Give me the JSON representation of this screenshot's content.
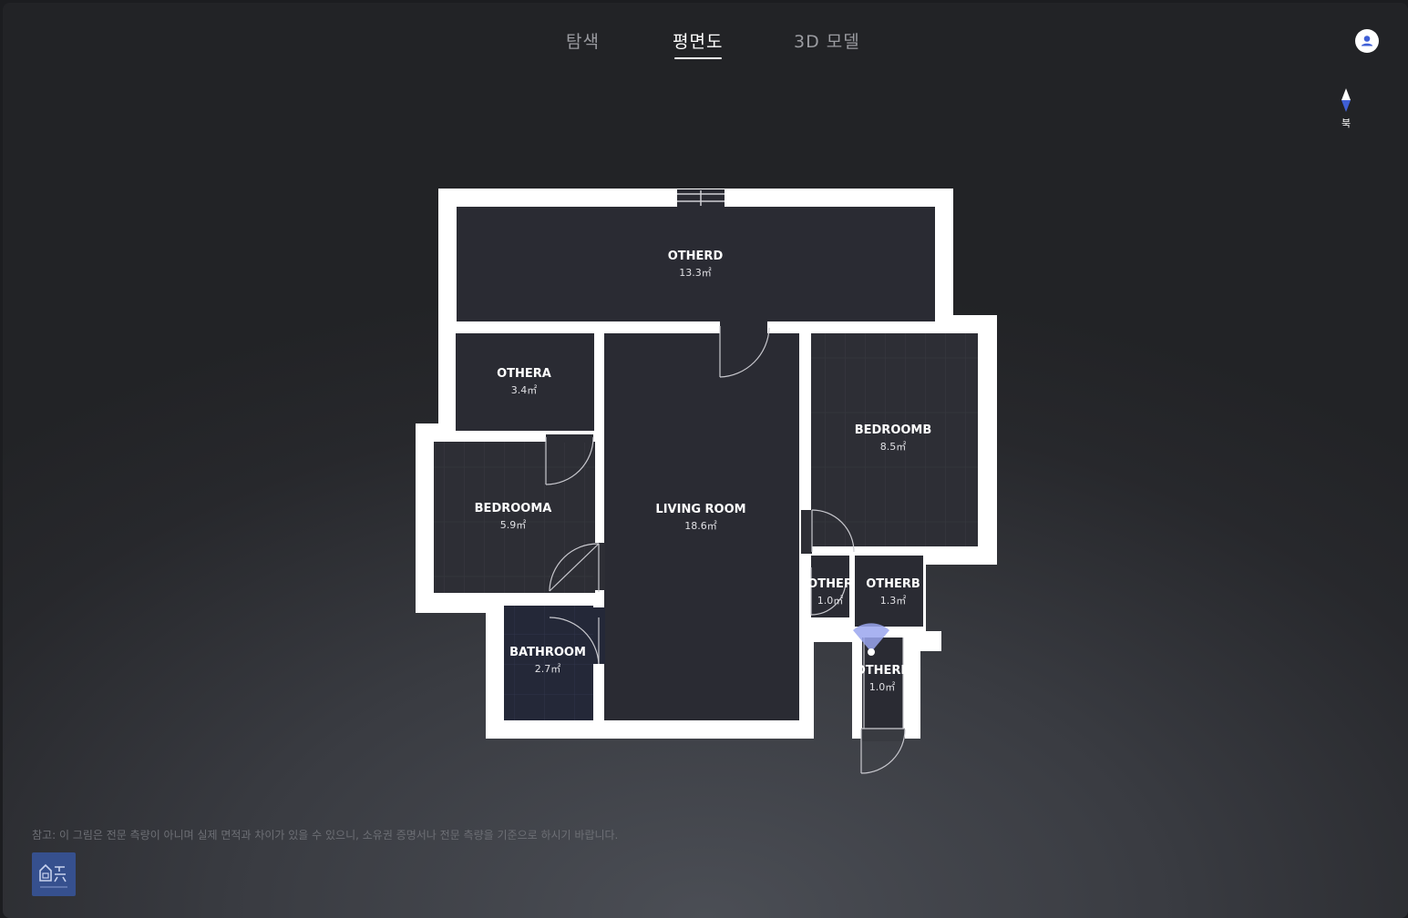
{
  "tabs": [
    {
      "label": "탐색",
      "active": false
    },
    {
      "label": "평면도",
      "active": true
    },
    {
      "label": "3D 모델",
      "active": false
    }
  ],
  "compass": {
    "label": "북"
  },
  "rooms": {
    "otherd": {
      "name": "OTHERD",
      "area": "13.3㎡"
    },
    "othera": {
      "name": "OTHERA",
      "area": "3.4㎡"
    },
    "bedrooma": {
      "name": "BEDROOMA",
      "area": "5.9㎡"
    },
    "living": {
      "name": "LIVING ROOM",
      "area": "18.6㎡"
    },
    "bedroomb": {
      "name": "BEDROOMB",
      "area": "8.5㎡"
    },
    "other": {
      "name": "OTHER",
      "area": "1.0㎡"
    },
    "otherb": {
      "name": "OTHERB",
      "area": "1.3㎡"
    },
    "othere": {
      "name": "OTHERE",
      "area": "1.0㎡"
    },
    "bathroom": {
      "name": "BATHROOM",
      "area": "2.7㎡"
    }
  },
  "disclaimer": "참고: 이 그림은 전문 측량이 아니며 실제 면적과 차이가 있을 수 있으니, 소유권 증명서나 전문 측량을 기준으로 하시기 바랍니다.",
  "colors": {
    "wall": "#ffffff",
    "floor": "#2a2b33",
    "accent": "#3f5fd6",
    "logo": "#36508e"
  }
}
